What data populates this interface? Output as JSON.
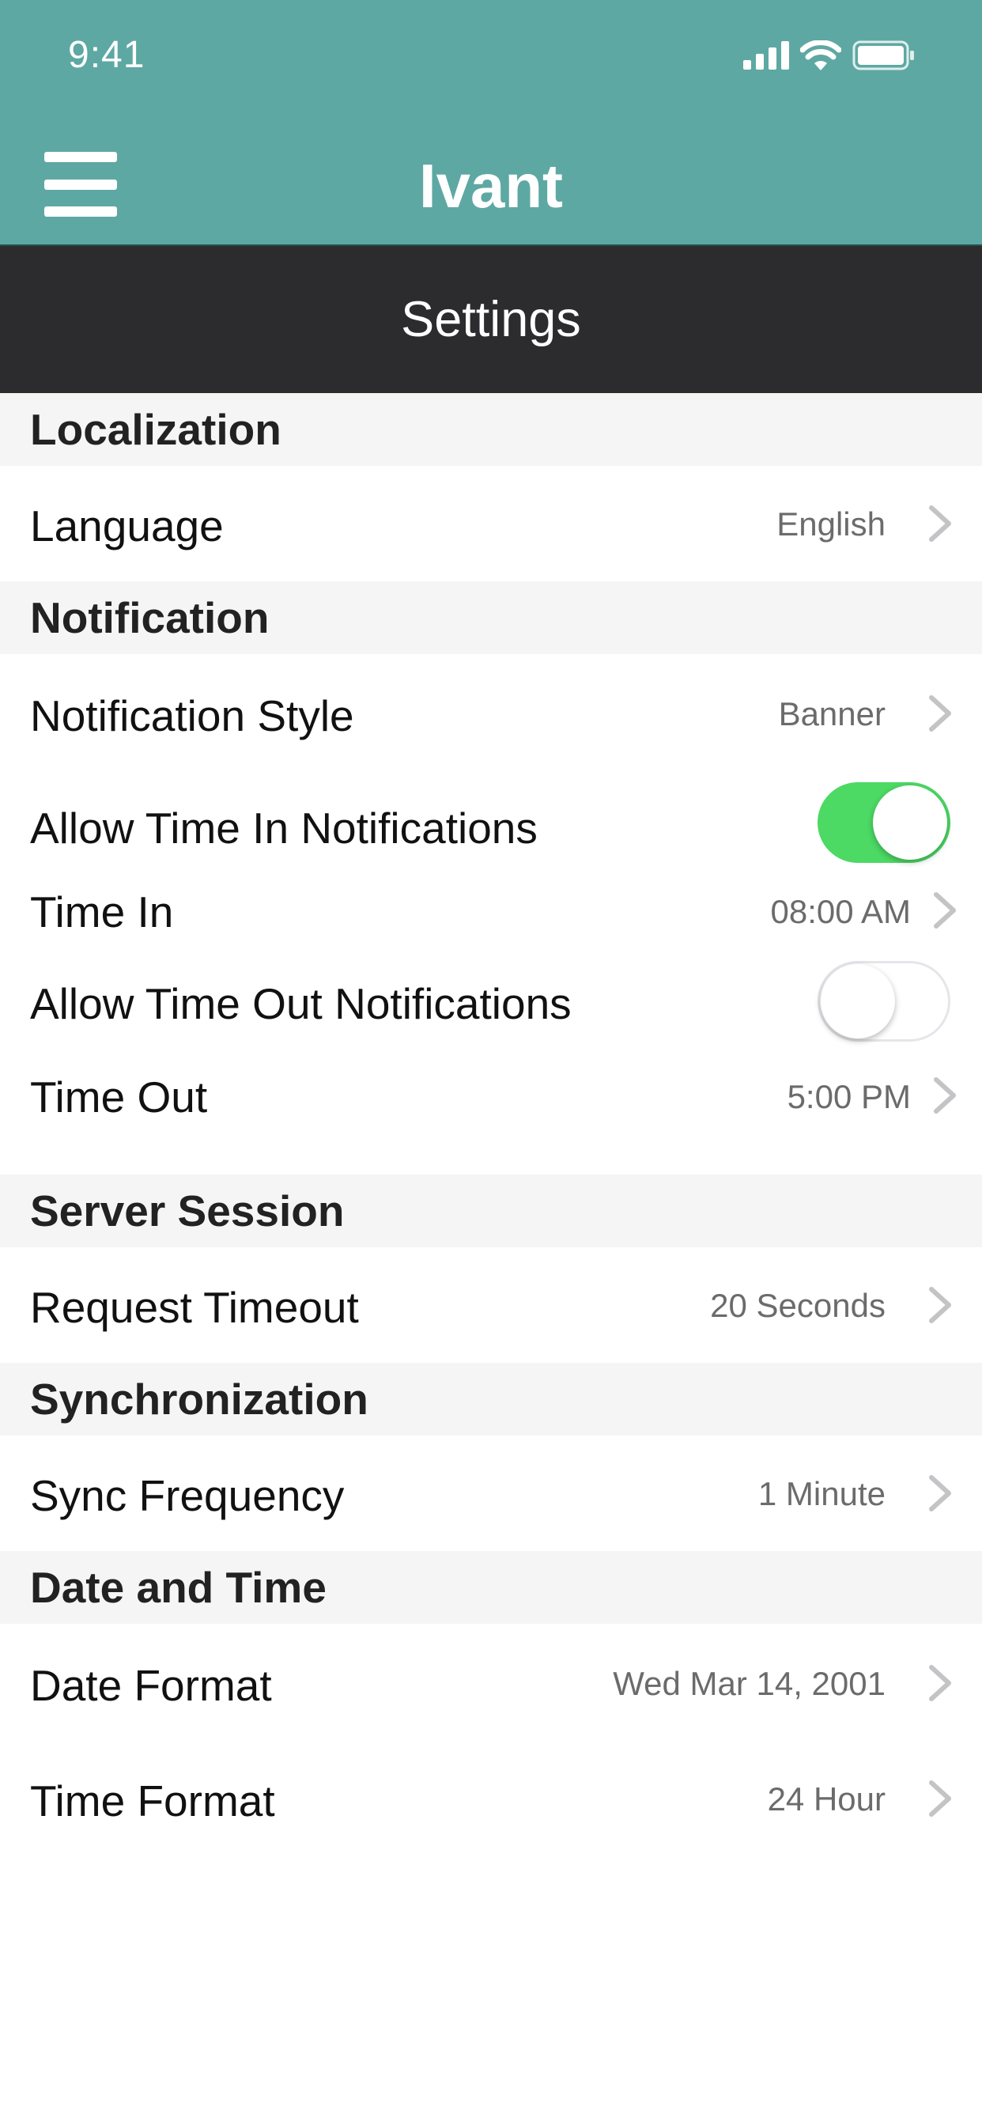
{
  "status_bar": {
    "time": "9:41",
    "icons": [
      "cellular-signal-icon",
      "wifi-icon",
      "battery-icon"
    ]
  },
  "header": {
    "app_title": "Ivant",
    "menu_icon": "hamburger-menu-icon"
  },
  "page": {
    "title": "Settings"
  },
  "sections": {
    "localization": {
      "title": "Localization",
      "language": {
        "label": "Language",
        "value": "English"
      }
    },
    "notification": {
      "title": "Notification",
      "style": {
        "label": "Notification Style",
        "value": "Banner"
      },
      "allow_time_in": {
        "label": "Allow Time In Notifications",
        "enabled": true
      },
      "time_in": {
        "label": "Time In",
        "value": "08:00 AM"
      },
      "allow_time_out": {
        "label": "Allow Time Out Notifications",
        "enabled": false
      },
      "time_out": {
        "label": "Time Out",
        "value": "5:00 PM"
      }
    },
    "server_session": {
      "title": "Server Session",
      "request_timeout": {
        "label": "Request Timeout",
        "value": "20 Seconds"
      }
    },
    "synchronization": {
      "title": "Synchronization",
      "sync_frequency": {
        "label": "Sync Frequency",
        "value": "1 Minute"
      }
    },
    "date_time": {
      "title": "Date and Time",
      "date_format": {
        "label": "Date Format",
        "value": "Wed Mar 14, 2001"
      },
      "time_format": {
        "label": "Time Format",
        "value": "24 Hour"
      }
    }
  },
  "colors": {
    "header_bg": "#5ea8a3",
    "titlebar_bg": "#2c2c2e",
    "section_bg": "#f5f5f5",
    "toggle_on": "#4cd964"
  }
}
